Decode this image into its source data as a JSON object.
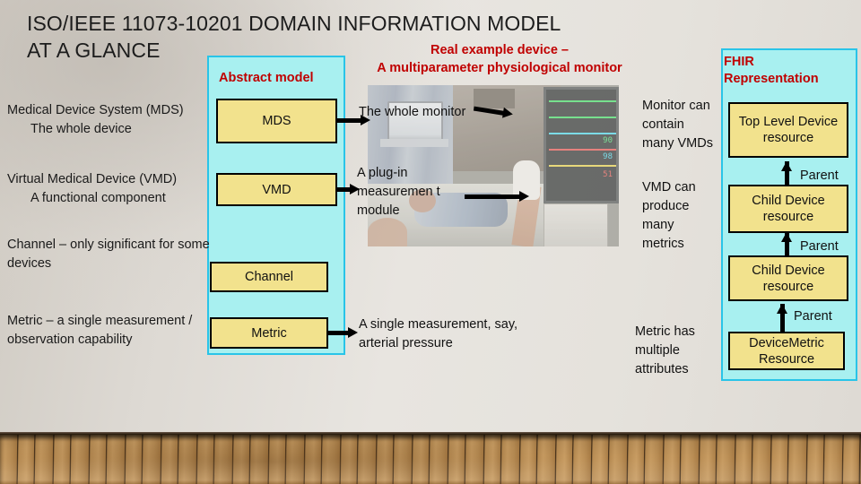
{
  "slide": {
    "title": "ISO/IEEE 11073-10201 DOMAIN INFORMATION MODEL AT A GLANCE",
    "background": {
      "wall_color": "#e0ddd7",
      "floor_color": "#b4884f"
    }
  },
  "colors": {
    "panel_fill": "#a8f0f0",
    "panel_border": "#29c4e8",
    "box_fill": "#f2e28d",
    "box_border": "#000000",
    "heading_red": "#c00000",
    "text": "#111111"
  },
  "columns": {
    "abstract": {
      "heading": "Abstract model",
      "boxes": [
        {
          "label": "MDS"
        },
        {
          "label": "VMD"
        },
        {
          "label": "Channel"
        },
        {
          "label": "Metric"
        }
      ]
    },
    "real_device": {
      "heading_line1": "Real example device –",
      "heading_line2": "A multiparameter physiological monitor",
      "photo_caption_whole": "The whole monitor",
      "photo_caption_plugin": "A plug-in measurement module",
      "photo_caption_single": "A single measurement, say, arterial pressure"
    },
    "fhir": {
      "heading_line1": "FHIR",
      "heading_line2": "Representation",
      "boxes": [
        {
          "label": "Top Level Device resource"
        },
        {
          "label": "Child Device resource"
        },
        {
          "label": "Child Device resource"
        },
        {
          "label": "DeviceMetric Resource"
        }
      ],
      "relations": [
        {
          "label": "Parent"
        },
        {
          "label": "Parent"
        },
        {
          "label": "Parent"
        }
      ]
    }
  },
  "left_definitions": [
    {
      "term": "Medical Device System (MDS)",
      "detail": "The whole device"
    },
    {
      "term": "Virtual Medical Device (VMD)",
      "detail": "A functional component"
    },
    {
      "term": "Channel – only significant for some devices",
      "detail": ""
    },
    {
      "term": "Metric – a single measurement / observation capability",
      "detail": ""
    }
  ],
  "right_notes": [
    {
      "text": "Monitor can contain many VMDs"
    },
    {
      "text": "VMD can produce many metrics"
    },
    {
      "text": "Metric has multiple attributes"
    }
  ],
  "center_notes": {
    "whole_monitor": "The whole monitor",
    "plugin_module": "A plug-in measuremen t module",
    "single_measurement": "A single measurement, say, arterial pressure"
  }
}
